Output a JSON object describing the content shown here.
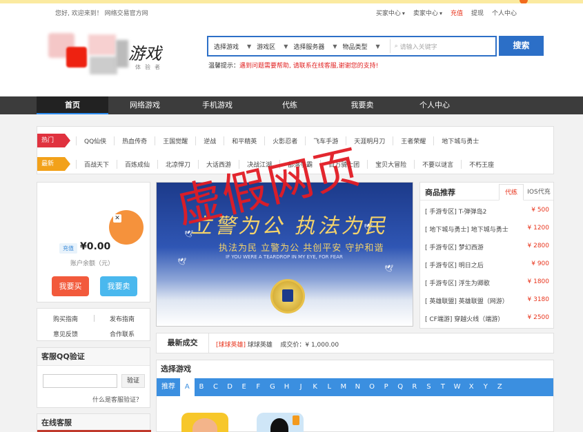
{
  "topbar": {
    "welcome": "您好, 欢迎来到！ 网络交易官方网",
    "links": [
      "买家中心",
      "卖家中心",
      "充值",
      "提现",
      "个人中心"
    ]
  },
  "logo": {
    "text": "游戏",
    "sub": "体验者"
  },
  "search": {
    "selects": [
      "选择游戏",
      "游戏区",
      "选择服务器",
      "物品类型"
    ],
    "placeholder": "请输入关键字",
    "button": "搜索"
  },
  "tip": {
    "label": "温馨提示：",
    "text": "遇到问题需要帮助, 请联系在线客服,谢谢您的支持!"
  },
  "nav": [
    "首页",
    "网络游戏",
    "手机游戏",
    "代练",
    "我要卖",
    "个人中心"
  ],
  "tags": {
    "hot_label": "热门",
    "hot": [
      "QQ仙侠",
      "热血传奇",
      "王国觉醒",
      "逆战",
      "和平精英",
      "火影忍者",
      "飞车手游",
      "天涯明月刀",
      "王者荣耀",
      "地下城与勇士"
    ],
    "new_label": "最新",
    "new": [
      "百战天下",
      "百炼成仙",
      "北凉悍刀",
      "大话西游",
      "决战江湖",
      "部落争霸",
      "百万骑士团",
      "宝贝大冒险",
      "不要以谜言",
      "不朽王座"
    ]
  },
  "account": {
    "recharge": "充值",
    "balance": "¥0.00",
    "balance_label": "账户余额（元）",
    "buy": "我要买",
    "sell": "我要卖"
  },
  "guide": [
    "购买指南",
    "发布指南",
    "意见反馈",
    "合作联系"
  ],
  "qq": {
    "title": "客服QQ验证",
    "button": "验证",
    "link": "什么是客服验证？"
  },
  "online_title": "在线客服",
  "banner": {
    "title": "立警为公 执法为民",
    "subtitle": "执法为民  立警为公  共创平安  守护和谐",
    "en": "IF YOU WERE A TEARDROP IN MY EYE, FOR FEAR"
  },
  "stamp": "虚假网页",
  "recommend": {
    "title": "商品推荐",
    "tabs": [
      "代练",
      "IOS代充"
    ],
    "items": [
      {
        "name": "[ 手游专区] T-弹弹岛2",
        "price": "¥ 500"
      },
      {
        "name": "[ 地下城与勇士] 地下城与勇士",
        "price": "¥ 1200"
      },
      {
        "name": "[ 手游专区] 梦幻西游",
        "price": "¥ 2800"
      },
      {
        "name": "[ 手游专区] 明日之后",
        "price": "¥ 900"
      },
      {
        "name": "[ 手游专区] 浮生为卿歌",
        "price": "¥ 1800"
      },
      {
        "name": "[ 英雄联盟] 英雄联盟（网游）",
        "price": "¥ 3180"
      },
      {
        "name": "[ CF端游] 穿越火线（端游）",
        "price": "¥ 2500"
      }
    ]
  },
  "deal": {
    "title": "最新成交",
    "tag": "[球球英雄]",
    "game": "球球英雄",
    "price": "成交价：¥ 1,000.00"
  },
  "select_game": {
    "title": "选择游戏",
    "recommend": "推荐",
    "letters": [
      "A",
      "B",
      "C",
      "D",
      "E",
      "F",
      "G",
      "H",
      "J",
      "K",
      "L",
      "M",
      "N",
      "O",
      "P",
      "Q",
      "R",
      "S",
      "T",
      "W",
      "X",
      "Y",
      "Z"
    ]
  }
}
